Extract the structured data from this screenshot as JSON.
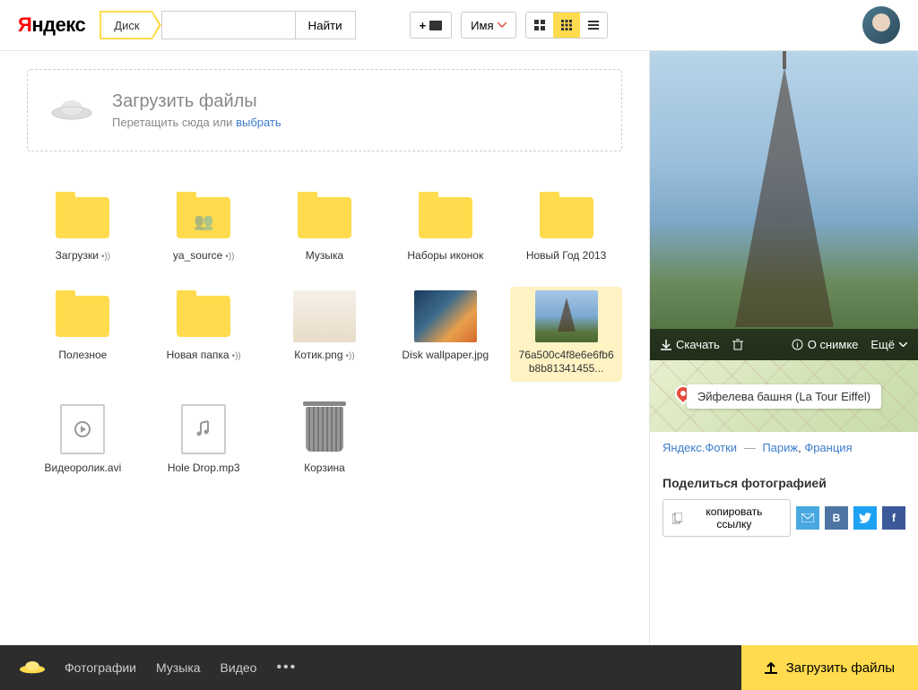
{
  "header": {
    "logo_text": "Яндекс",
    "service_tag": "Диск",
    "search_button": "Найти",
    "sort_label": "Имя"
  },
  "dropzone": {
    "title": "Загрузить файлы",
    "text_prefix": "Перетащить сюда или ",
    "link": "выбрать"
  },
  "files": [
    {
      "name": "Загрузки",
      "type": "folder",
      "shared": true
    },
    {
      "name": "ya_source",
      "type": "folder",
      "shared": true,
      "people": true
    },
    {
      "name": "Музыка",
      "type": "folder"
    },
    {
      "name": "Наборы иконок",
      "type": "folder"
    },
    {
      "name": "Новый Год 2013",
      "type": "folder"
    },
    {
      "name": "Полезное",
      "type": "folder"
    },
    {
      "name": "Новая папка",
      "type": "folder",
      "shared": true
    },
    {
      "name": "Котик.png",
      "type": "image",
      "thumb": "cat",
      "shared": true
    },
    {
      "name": "Disk wallpaper.jpg",
      "type": "image",
      "thumb": "wallpaper"
    },
    {
      "name": "76a500c4f8e6e6fb6b8b81341455...",
      "type": "image",
      "thumb": "eiffel",
      "selected": true
    },
    {
      "name": "Видеоролик.avi",
      "type": "video"
    },
    {
      "name": "Hole Drop.mp3",
      "type": "audio"
    },
    {
      "name": "Корзина",
      "type": "trash"
    }
  ],
  "preview": {
    "download": "Скачать",
    "about": "О снимке",
    "more": "Ещё",
    "map_label": "Эйфелева башня (La Tour Eiffel)",
    "bc_service": "Яндекс.Фотки",
    "bc_loc1": "Париж",
    "bc_loc2": "Франция",
    "share_title": "Поделиться фотографией",
    "copy_link": "копировать ссылку"
  },
  "footer": {
    "photos": "Фотографии",
    "music": "Музыка",
    "video": "Видео",
    "upload": "Загрузить файлы"
  }
}
